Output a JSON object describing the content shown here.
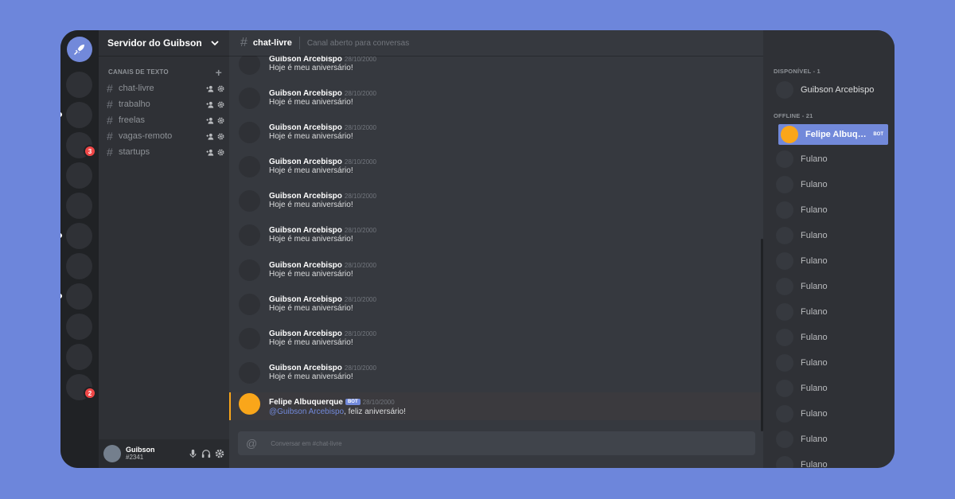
{
  "server": {
    "name": "Servidor do Guibson"
  },
  "rail": {
    "badges": [
      "3",
      "2"
    ]
  },
  "category": {
    "label": "CANAIS DE TEXTO"
  },
  "channels": [
    {
      "name": "chat-livre"
    },
    {
      "name": "trabalho"
    },
    {
      "name": "freelas"
    },
    {
      "name": "vagas-remoto"
    },
    {
      "name": "startups"
    }
  ],
  "user": {
    "name": "Guibson",
    "tag": "#2341"
  },
  "topbar": {
    "channel": "chat-livre",
    "topic": "Canal aberto para conversas"
  },
  "messages": [
    {
      "author": "Guibson Arcebispo",
      "date": "28/10/2000",
      "text": "Hoje é meu aniversário!"
    },
    {
      "author": "Guibson Arcebispo",
      "date": "28/10/2000",
      "text": "Hoje é meu aniversário!"
    },
    {
      "author": "Guibson Arcebispo",
      "date": "28/10/2000",
      "text": "Hoje é meu aniversário!"
    },
    {
      "author": "Guibson Arcebispo",
      "date": "28/10/2000",
      "text": "Hoje é meu aniversário!"
    },
    {
      "author": "Guibson Arcebispo",
      "date": "28/10/2000",
      "text": "Hoje é meu aniversário!"
    },
    {
      "author": "Guibson Arcebispo",
      "date": "28/10/2000",
      "text": "Hoje é meu aniversário!"
    },
    {
      "author": "Guibson Arcebispo",
      "date": "28/10/2000",
      "text": "Hoje é meu aniversário!"
    },
    {
      "author": "Guibson Arcebispo",
      "date": "28/10/2000",
      "text": "Hoje é meu aniversário!"
    },
    {
      "author": "Guibson Arcebispo",
      "date": "28/10/2000",
      "text": "Hoje é meu aniversário!"
    },
    {
      "author": "Guibson Arcebispo",
      "date": "28/10/2000",
      "text": "Hoje é meu aniversário!"
    }
  ],
  "bot_message": {
    "author": "Felipe Albuquerque",
    "badge": "BOT",
    "date": "28/10/2000",
    "mention": "@Guibson Arcebispo",
    "text": ", feliz aniversário!"
  },
  "input": {
    "placeholder": "Conversar em #chat-livre"
  },
  "members": {
    "online_header": "DISPONÍVEL - 1",
    "online": [
      {
        "name": "Guibson Arcebispo"
      }
    ],
    "offline_header": "OFFLINE - 21",
    "bot": {
      "name": "Felipe Albuquerque",
      "badge": "BOT"
    },
    "offline": [
      {
        "name": "Fulano"
      },
      {
        "name": "Fulano"
      },
      {
        "name": "Fulano"
      },
      {
        "name": "Fulano"
      },
      {
        "name": "Fulano"
      },
      {
        "name": "Fulano"
      },
      {
        "name": "Fulano"
      },
      {
        "name": "Fulano"
      },
      {
        "name": "Fulano"
      },
      {
        "name": "Fulano"
      },
      {
        "name": "Fulano"
      },
      {
        "name": "Fulano"
      },
      {
        "name": "Fulano"
      }
    ]
  },
  "colors": {
    "brand": "#7289da",
    "accent": "#faa61a",
    "badge": "#f04747",
    "background": "#6d86db"
  }
}
